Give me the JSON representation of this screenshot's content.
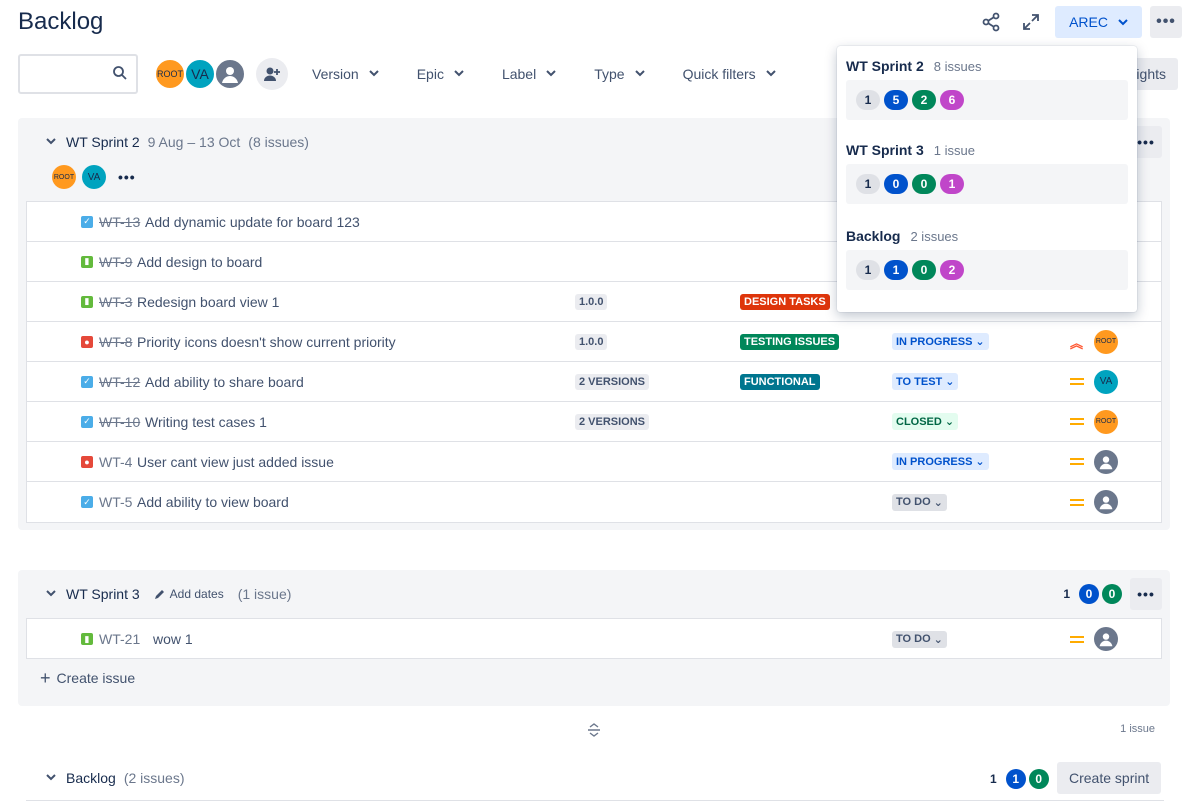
{
  "page": {
    "title": "Backlog"
  },
  "header": {
    "project_button": "AREC"
  },
  "filters": {
    "search_placeholder": "",
    "avatars": [
      "ROOT",
      "VA"
    ],
    "items": [
      "Version",
      "Epic",
      "Label",
      "Type",
      "Quick filters"
    ],
    "insights_button": "Insights"
  },
  "popup": {
    "sections": [
      {
        "name": "WT Sprint 2",
        "count": "8 issues",
        "pills": [
          "1",
          "5",
          "2",
          "6"
        ]
      },
      {
        "name": "WT Sprint 3",
        "count": "1 issue",
        "pills": [
          "1",
          "0",
          "0",
          "1"
        ]
      },
      {
        "name": "Backlog",
        "count": "2 issues",
        "pills": [
          "1",
          "1",
          "0",
          "2"
        ]
      }
    ]
  },
  "sprint2": {
    "name": "WT Sprint 2",
    "dates": "9 Aug – 13 Oct",
    "count": "(8 issues)",
    "avatars": [
      "ROOT",
      "VA"
    ],
    "issues": [
      {
        "key": "WT-13",
        "summary": "Add dynamic update for board 123",
        "type": "task",
        "done": true,
        "version": "",
        "epic": "",
        "status": "",
        "priority": "",
        "assignee": ""
      },
      {
        "key": "WT-9",
        "summary": "Add design to board",
        "type": "story",
        "done": true,
        "version": "",
        "epic": "",
        "status": "",
        "priority": "",
        "assignee": ""
      },
      {
        "key": "WT-3",
        "summary": "Redesign board view 1",
        "type": "story",
        "done": true,
        "version": "1.0.0",
        "epic": "DESIGN TASKS",
        "status": "",
        "priority": "",
        "assignee": ""
      },
      {
        "key": "WT-8",
        "summary": "Priority icons doesn't show current priority",
        "type": "bug",
        "done": true,
        "version": "1.0.0",
        "epic": "TESTING ISSUES",
        "status": "IN PROGRESS",
        "priority": "high",
        "assignee": "ROOT"
      },
      {
        "key": "WT-12",
        "summary": "Add ability to share board",
        "type": "task",
        "done": true,
        "version": "2 VERSIONS",
        "epic": "FUNCTIONAL",
        "status": "TO TEST",
        "priority": "medium",
        "assignee": "VA"
      },
      {
        "key": "WT-10",
        "summary": "Writing test cases 1",
        "type": "task",
        "done": true,
        "version": "2 VERSIONS",
        "epic": "",
        "status": "CLOSED",
        "priority": "medium",
        "assignee": "ROOT"
      },
      {
        "key": "WT-4",
        "summary": "User cant view just added issue",
        "type": "bug",
        "done": false,
        "version": "",
        "epic": "",
        "status": "IN PROGRESS",
        "priority": "medium",
        "assignee": ""
      },
      {
        "key": "WT-5",
        "summary": "Add ability to view board",
        "type": "task",
        "done": false,
        "version": "",
        "epic": "",
        "status": "TO DO",
        "priority": "medium",
        "assignee": ""
      }
    ]
  },
  "sprint3": {
    "name": "WT Sprint 3",
    "add_dates": "Add dates",
    "count": "(1 issue)",
    "pills": [
      "1",
      "0",
      "0"
    ],
    "issue": {
      "key": "WT-21",
      "summary": "wow 1",
      "status": "TO DO"
    },
    "create_issue": "Create issue"
  },
  "footer": {
    "issue_count": "1 issue"
  },
  "backlog": {
    "name": "Backlog",
    "count": "(2 issues)",
    "pills": [
      "1",
      "1",
      "0"
    ],
    "create_sprint": "Create sprint"
  },
  "colors": {
    "epic_design": "#de350b",
    "epic_testing": "#00875a",
    "epic_functional": "#00768f"
  }
}
